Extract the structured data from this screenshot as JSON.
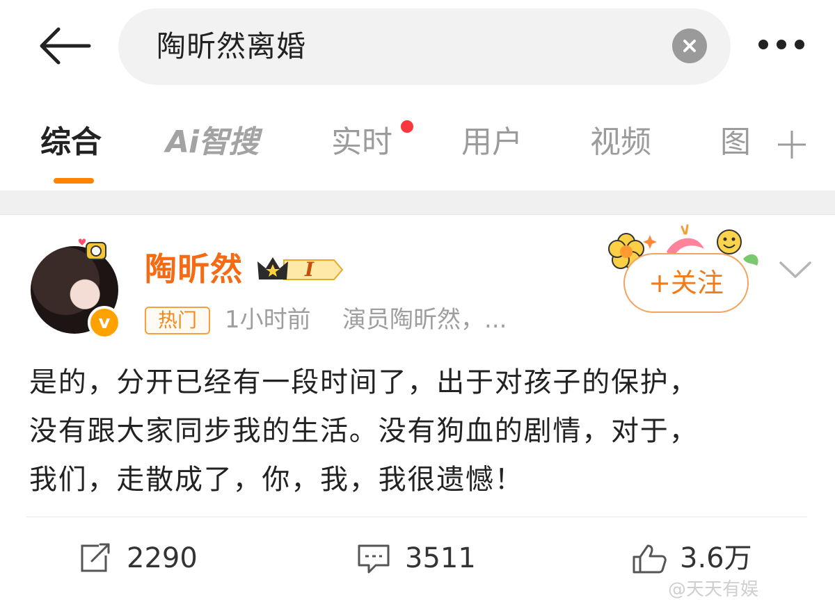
{
  "search": {
    "query": "陶昕然离婚"
  },
  "tabs": [
    {
      "label": "综合",
      "active": true
    },
    {
      "label": "Ai智搜"
    },
    {
      "label": "实时",
      "has_new_dot": true
    },
    {
      "label": "用户"
    },
    {
      "label": "视频"
    },
    {
      "label": "图"
    }
  ],
  "post": {
    "username": "陶昕然",
    "level_badge": "I",
    "hot_tag": "热门",
    "time": "1小时前",
    "source": "演员陶昕然，...",
    "follow_label": "+关注",
    "verified_mark": "v",
    "text_lines": [
      "是的，分开已经有一段时间了，出于对孩子的保护，",
      "没有跟大家同步我的生活。没有狗血的剧情，对于，",
      "我们，走散成了，你，我，我很遗憾！"
    ],
    "actions": {
      "reposts": "2290",
      "comments": "3511",
      "likes": "3.6万"
    }
  },
  "watermark": "@天天有娱",
  "colors": {
    "accent": "#ff8200",
    "username": "#f56a13",
    "notification_dot": "#f8383a"
  }
}
